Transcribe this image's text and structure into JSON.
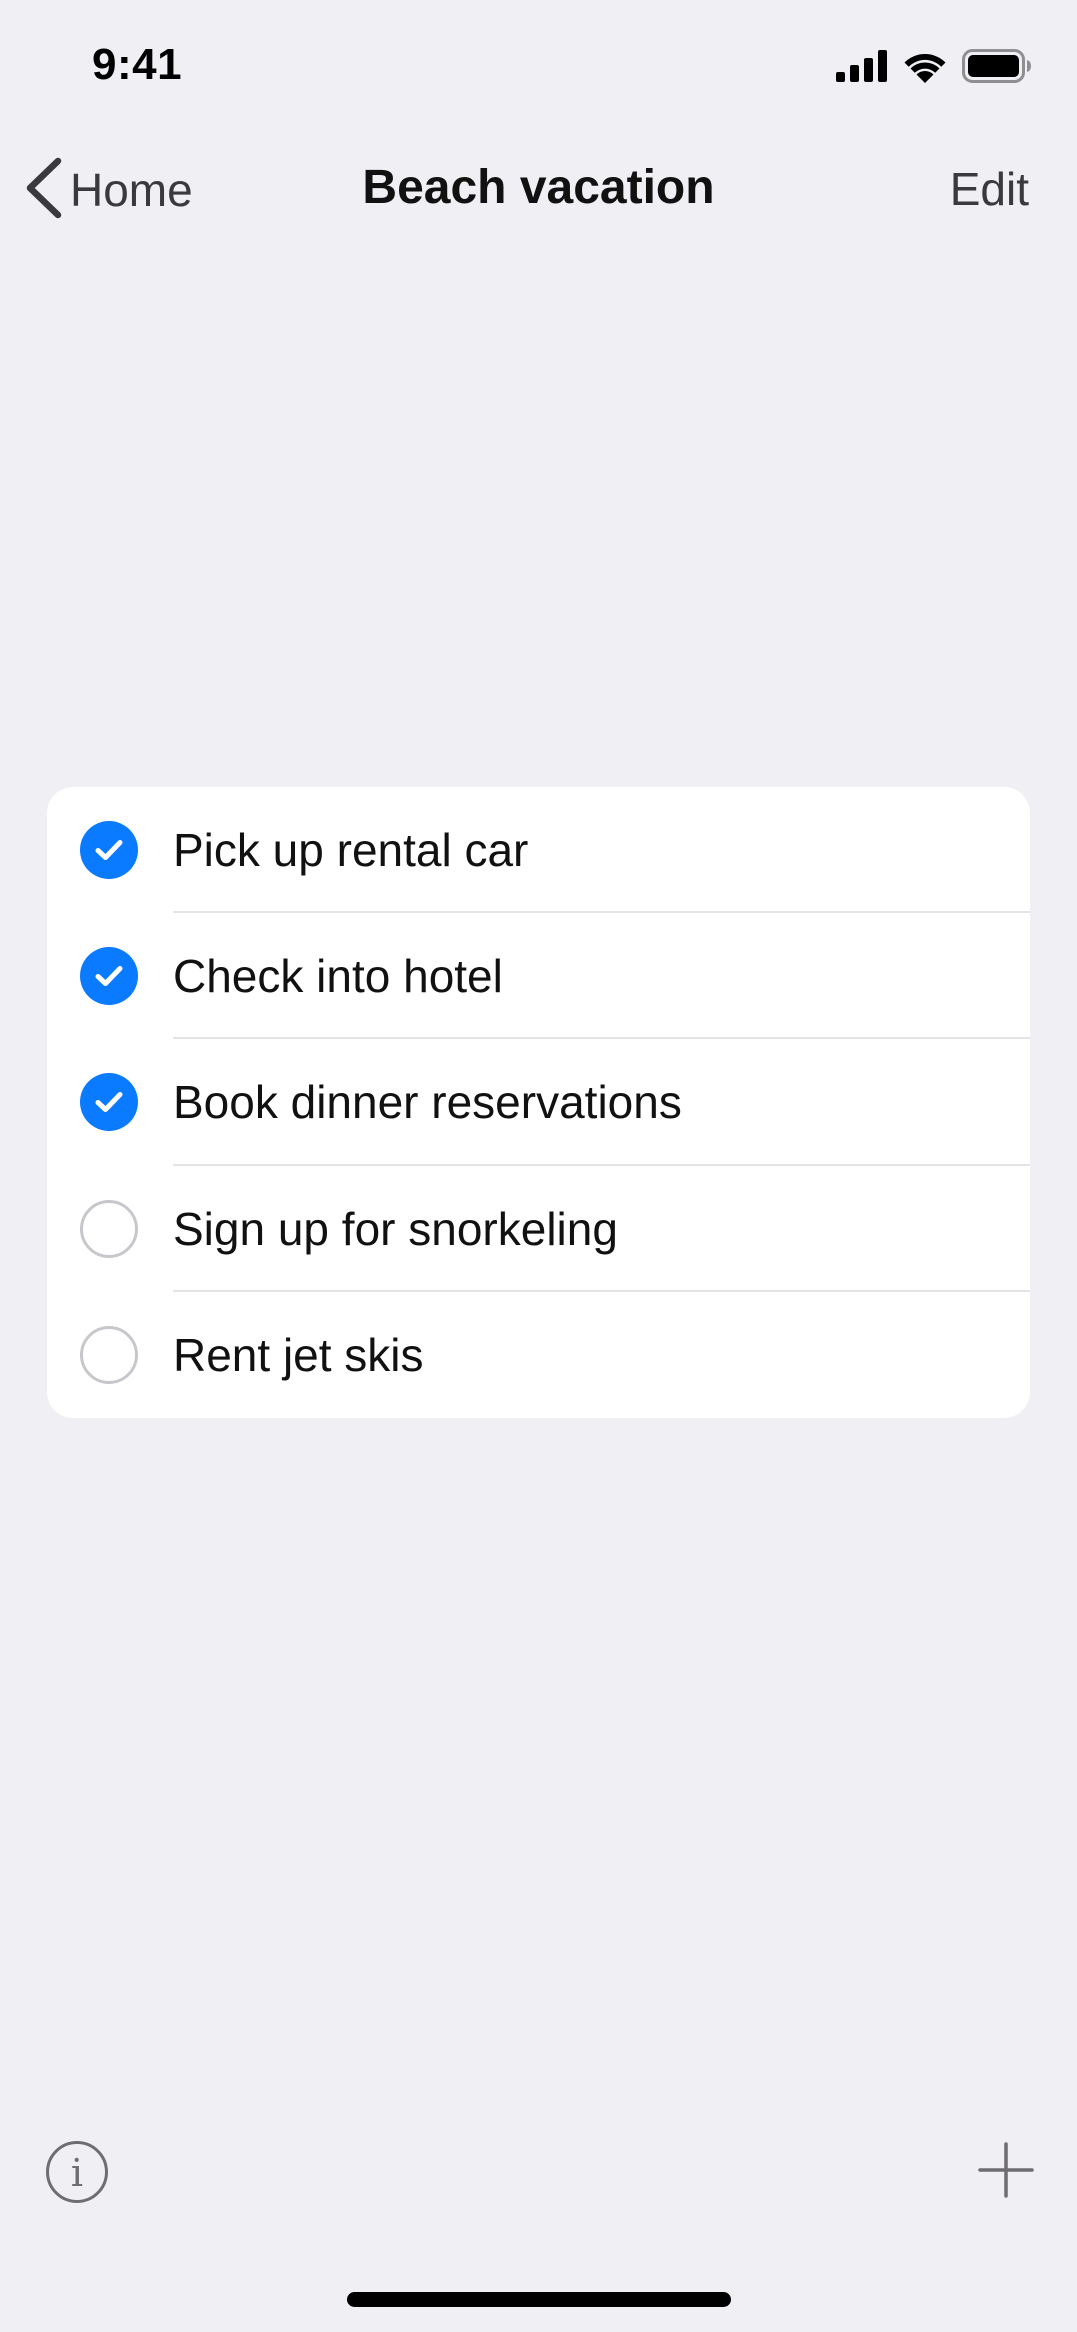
{
  "status_bar": {
    "time": "9:41",
    "icons": [
      "cellular-signal-icon",
      "wifi-icon",
      "battery-icon"
    ]
  },
  "nav": {
    "back_label": "Home",
    "title": "Beach vacation",
    "edit_label": "Edit"
  },
  "list": {
    "items": [
      {
        "label": "Pick up rental car",
        "checked": true
      },
      {
        "label": "Check into hotel",
        "checked": true
      },
      {
        "label": "Book dinner reservations",
        "checked": true
      },
      {
        "label": "Sign up for snorkeling",
        "checked": false
      },
      {
        "label": "Rent jet skis",
        "checked": false
      }
    ]
  },
  "toolbar": {
    "left_icon": "info-icon",
    "right_icon": "plus-icon"
  },
  "colors": {
    "background": "#efeff4",
    "accent": "#0a7aff",
    "unchecked_border": "#c7c7cc",
    "nav_text": "#3a3a3c"
  }
}
